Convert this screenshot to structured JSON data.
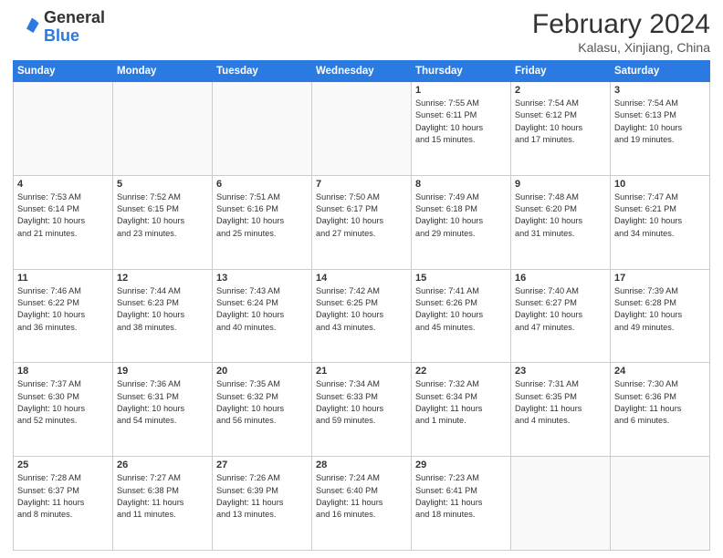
{
  "header": {
    "logo_general": "General",
    "logo_blue": "Blue",
    "month_title": "February 2024",
    "location": "Kalasu, Xinjiang, China"
  },
  "weekdays": [
    "Sunday",
    "Monday",
    "Tuesday",
    "Wednesday",
    "Thursday",
    "Friday",
    "Saturday"
  ],
  "weeks": [
    [
      {
        "day": "",
        "info": ""
      },
      {
        "day": "",
        "info": ""
      },
      {
        "day": "",
        "info": ""
      },
      {
        "day": "",
        "info": ""
      },
      {
        "day": "1",
        "info": "Sunrise: 7:55 AM\nSunset: 6:11 PM\nDaylight: 10 hours\nand 15 minutes."
      },
      {
        "day": "2",
        "info": "Sunrise: 7:54 AM\nSunset: 6:12 PM\nDaylight: 10 hours\nand 17 minutes."
      },
      {
        "day": "3",
        "info": "Sunrise: 7:54 AM\nSunset: 6:13 PM\nDaylight: 10 hours\nand 19 minutes."
      }
    ],
    [
      {
        "day": "4",
        "info": "Sunrise: 7:53 AM\nSunset: 6:14 PM\nDaylight: 10 hours\nand 21 minutes."
      },
      {
        "day": "5",
        "info": "Sunrise: 7:52 AM\nSunset: 6:15 PM\nDaylight: 10 hours\nand 23 minutes."
      },
      {
        "day": "6",
        "info": "Sunrise: 7:51 AM\nSunset: 6:16 PM\nDaylight: 10 hours\nand 25 minutes."
      },
      {
        "day": "7",
        "info": "Sunrise: 7:50 AM\nSunset: 6:17 PM\nDaylight: 10 hours\nand 27 minutes."
      },
      {
        "day": "8",
        "info": "Sunrise: 7:49 AM\nSunset: 6:18 PM\nDaylight: 10 hours\nand 29 minutes."
      },
      {
        "day": "9",
        "info": "Sunrise: 7:48 AM\nSunset: 6:20 PM\nDaylight: 10 hours\nand 31 minutes."
      },
      {
        "day": "10",
        "info": "Sunrise: 7:47 AM\nSunset: 6:21 PM\nDaylight: 10 hours\nand 34 minutes."
      }
    ],
    [
      {
        "day": "11",
        "info": "Sunrise: 7:46 AM\nSunset: 6:22 PM\nDaylight: 10 hours\nand 36 minutes."
      },
      {
        "day": "12",
        "info": "Sunrise: 7:44 AM\nSunset: 6:23 PM\nDaylight: 10 hours\nand 38 minutes."
      },
      {
        "day": "13",
        "info": "Sunrise: 7:43 AM\nSunset: 6:24 PM\nDaylight: 10 hours\nand 40 minutes."
      },
      {
        "day": "14",
        "info": "Sunrise: 7:42 AM\nSunset: 6:25 PM\nDaylight: 10 hours\nand 43 minutes."
      },
      {
        "day": "15",
        "info": "Sunrise: 7:41 AM\nSunset: 6:26 PM\nDaylight: 10 hours\nand 45 minutes."
      },
      {
        "day": "16",
        "info": "Sunrise: 7:40 AM\nSunset: 6:27 PM\nDaylight: 10 hours\nand 47 minutes."
      },
      {
        "day": "17",
        "info": "Sunrise: 7:39 AM\nSunset: 6:28 PM\nDaylight: 10 hours\nand 49 minutes."
      }
    ],
    [
      {
        "day": "18",
        "info": "Sunrise: 7:37 AM\nSunset: 6:30 PM\nDaylight: 10 hours\nand 52 minutes."
      },
      {
        "day": "19",
        "info": "Sunrise: 7:36 AM\nSunset: 6:31 PM\nDaylight: 10 hours\nand 54 minutes."
      },
      {
        "day": "20",
        "info": "Sunrise: 7:35 AM\nSunset: 6:32 PM\nDaylight: 10 hours\nand 56 minutes."
      },
      {
        "day": "21",
        "info": "Sunrise: 7:34 AM\nSunset: 6:33 PM\nDaylight: 10 hours\nand 59 minutes."
      },
      {
        "day": "22",
        "info": "Sunrise: 7:32 AM\nSunset: 6:34 PM\nDaylight: 11 hours\nand 1 minute."
      },
      {
        "day": "23",
        "info": "Sunrise: 7:31 AM\nSunset: 6:35 PM\nDaylight: 11 hours\nand 4 minutes."
      },
      {
        "day": "24",
        "info": "Sunrise: 7:30 AM\nSunset: 6:36 PM\nDaylight: 11 hours\nand 6 minutes."
      }
    ],
    [
      {
        "day": "25",
        "info": "Sunrise: 7:28 AM\nSunset: 6:37 PM\nDaylight: 11 hours\nand 8 minutes."
      },
      {
        "day": "26",
        "info": "Sunrise: 7:27 AM\nSunset: 6:38 PM\nDaylight: 11 hours\nand 11 minutes."
      },
      {
        "day": "27",
        "info": "Sunrise: 7:26 AM\nSunset: 6:39 PM\nDaylight: 11 hours\nand 13 minutes."
      },
      {
        "day": "28",
        "info": "Sunrise: 7:24 AM\nSunset: 6:40 PM\nDaylight: 11 hours\nand 16 minutes."
      },
      {
        "day": "29",
        "info": "Sunrise: 7:23 AM\nSunset: 6:41 PM\nDaylight: 11 hours\nand 18 minutes."
      },
      {
        "day": "",
        "info": ""
      },
      {
        "day": "",
        "info": ""
      }
    ]
  ]
}
